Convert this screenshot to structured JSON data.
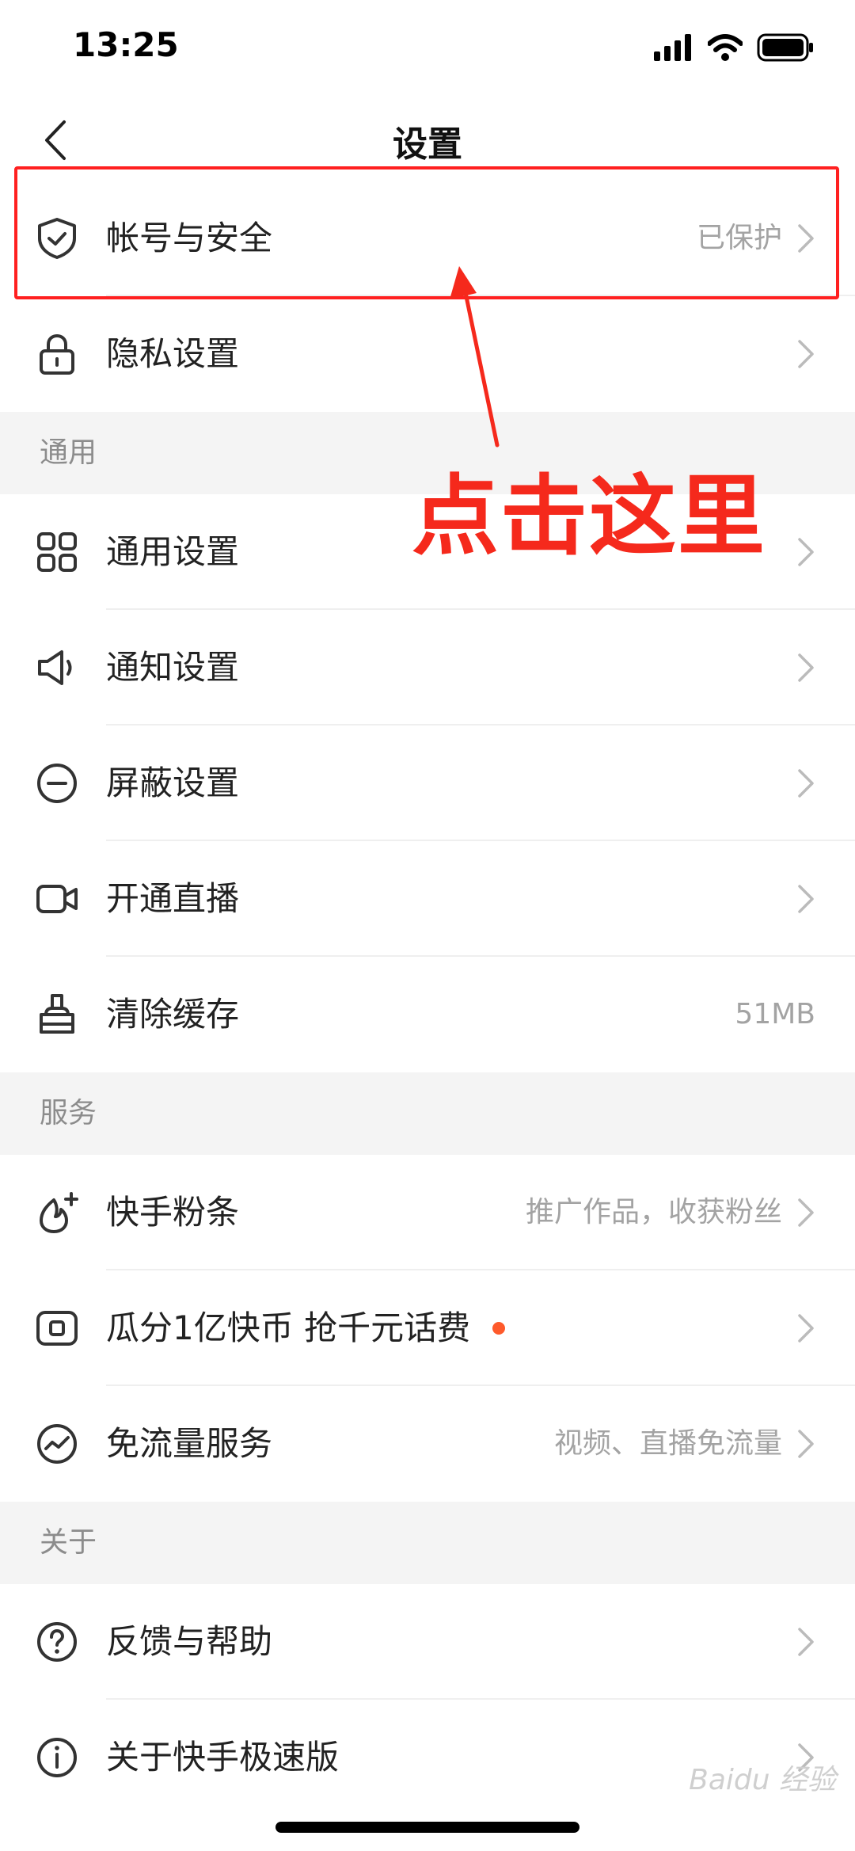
{
  "status_bar": {
    "time": "13:25"
  },
  "nav": {
    "title": "设置"
  },
  "rows_top": [
    {
      "label": "帐号与安全",
      "value": "已保护",
      "icon": "shield-check-icon"
    },
    {
      "label": "隐私设置",
      "value": "",
      "icon": "lock-icon"
    }
  ],
  "sections": [
    {
      "title": "通用",
      "items": [
        {
          "label": "通用设置",
          "value": "",
          "icon": "grid-icon"
        },
        {
          "label": "通知设置",
          "value": "",
          "icon": "speaker-icon"
        },
        {
          "label": "屏蔽设置",
          "value": "",
          "icon": "minus-circle-icon"
        },
        {
          "label": "开通直播",
          "value": "",
          "icon": "video-camera-icon"
        },
        {
          "label": "清除缓存",
          "value": "51MB",
          "icon": "brush-icon"
        }
      ]
    },
    {
      "title": "服务",
      "items": [
        {
          "label": "快手粉条",
          "value": "推广作品，收获粉丝",
          "icon": "flame-plus-icon"
        },
        {
          "label": "瓜分1亿快币 抢千元话费",
          "value": "",
          "icon": "coin-box-icon",
          "badge_color": "#fe5a2b"
        },
        {
          "label": "免流量服务",
          "value": "视频、直播免流量",
          "icon": "wave-circle-icon"
        }
      ]
    },
    {
      "title": "关于",
      "items": [
        {
          "label": "反馈与帮助",
          "value": "",
          "icon": "question-circle-icon"
        },
        {
          "label": "关于快手极速版",
          "value": "",
          "icon": "info-circle-icon"
        }
      ]
    }
  ],
  "annotation": {
    "text": "点击这里",
    "color": "#f5291c"
  },
  "watermark": {
    "text": "Baidu 经验"
  },
  "colors": {
    "highlight_border": "#ff2020",
    "section_bg": "#f4f4f4",
    "secondary_text": "#a3a3a3"
  }
}
